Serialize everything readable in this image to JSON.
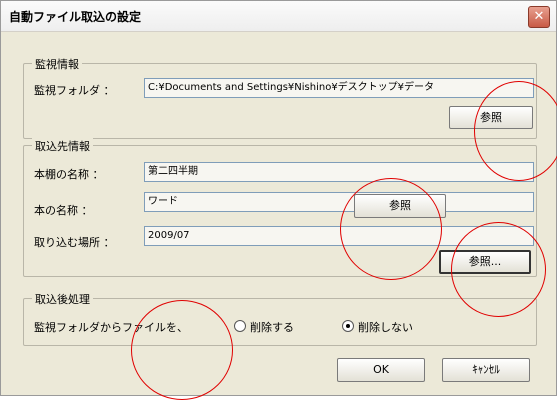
{
  "window": {
    "title": "自動ファイル取込の設定",
    "close_glyph": "✕"
  },
  "monitor_group": {
    "legend": "監視情報",
    "folder_label": "監視フォルダ ：",
    "folder_value": "C:¥Documents and Settings¥Nishino¥デスクトップ¥データ",
    "browse_label": "参照"
  },
  "import_group": {
    "legend": "取込先情報",
    "shelf_label": "本棚の名称 ：",
    "shelf_value": "第二四半期",
    "book_label": "本の名称 ：",
    "book_value": "ワード",
    "book_browse_label": "参照",
    "location_label": "取り込む場所 ：",
    "location_value": "2009/07",
    "location_browse_label": "参照..."
  },
  "post_group": {
    "legend": "取込後処理",
    "prompt": "監視フォルダからファイルを、",
    "option_delete": "削除する",
    "option_keep": "削除しない",
    "selected": "削除しない"
  },
  "footer": {
    "ok_label": "OK",
    "cancel_label": "ｷｬﾝｾﾙ"
  },
  "annotation_color": "#e00000"
}
